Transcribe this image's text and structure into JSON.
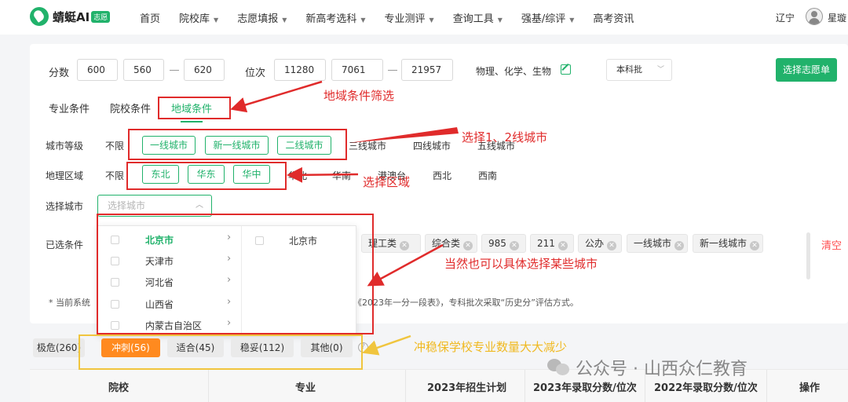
{
  "logo": {
    "name": "蜻蜓AI",
    "tag": "志愿"
  },
  "nav": [
    {
      "label": "首页",
      "caret": false
    },
    {
      "label": "院校库",
      "caret": true
    },
    {
      "label": "志愿填报",
      "caret": true
    },
    {
      "label": "新高考选科",
      "caret": true
    },
    {
      "label": "专业测评",
      "caret": true
    },
    {
      "label": "查询工具",
      "caret": true
    },
    {
      "label": "强基/综评",
      "caret": true
    },
    {
      "label": "高考资讯",
      "caret": false
    }
  ],
  "header": {
    "region": "辽宁",
    "user_name": "星璇"
  },
  "filters": {
    "score_label": "分数",
    "score_value": "600",
    "score_min": "560",
    "score_max": "620",
    "rank_label": "位次",
    "rank_value": "11280",
    "rank_min": "7061",
    "rank_max": "21957",
    "subjects": "物理、化学、生物",
    "batch": "本科批",
    "submit_label": "选择志愿单"
  },
  "tabs": [
    "专业条件",
    "院校条件",
    "地域条件"
  ],
  "city_level": {
    "label": "城市等级",
    "options": [
      "不限",
      "一线城市",
      "新一线城市",
      "二线城市",
      "三线城市",
      "四线城市",
      "五线城市"
    ]
  },
  "geo_region": {
    "label": "地理区域",
    "options": [
      "不限",
      "东北",
      "华东",
      "华中",
      "华北",
      "华南",
      "港澳台",
      "西北",
      "西南"
    ]
  },
  "city_select": {
    "label": "选择城市",
    "placeholder": "选择城市"
  },
  "selected": {
    "label": "已选条件",
    "tags": [
      "理工类",
      "综合类",
      "985",
      "211",
      "公办",
      "一线城市",
      "新一线城市"
    ],
    "clear_label": "清空"
  },
  "note": {
    "prefix": "* 当前系统",
    "suffix": "《2023年一分一段表》，专科批次采取“历史分”评估方式。"
  },
  "dropdown": {
    "provinces": [
      "北京市",
      "天津市",
      "河北省",
      "山西省",
      "内蒙古自治区"
    ],
    "cities": [
      "北京市"
    ]
  },
  "risk_tabs": [
    "极危(260)",
    "冲刺(56)",
    "适合(45)",
    "稳妥(112)",
    "其他(0)"
  ],
  "table_headers": [
    "院校",
    "专业",
    "2023年招生计划",
    "2023年录取分数/位次",
    "2022年录取分数/位次",
    "操作"
  ],
  "annotations": {
    "region_filter": "地域条件筛选",
    "city_levels": "选择1、2线城市",
    "regions": "选择区域",
    "cities": "当然也可以具体选择某些城市",
    "result": "冲稳保学校专业数量大大减少"
  },
  "watermark": "公众号 · 山西众仁教育",
  "colors": {
    "accent": "#21b26b",
    "annotation": "#e02b2b",
    "highlight": "#f0c53e",
    "sprint": "#ff8a1f"
  }
}
